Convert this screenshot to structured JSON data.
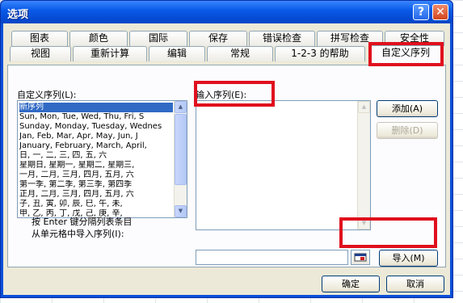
{
  "dialog": {
    "title": "选项",
    "help_label": "?",
    "close_label": "✕"
  },
  "tabs_row1": [
    "图表",
    "颜色",
    "国际",
    "保存",
    "错误检查",
    "拼写检查",
    "安全性"
  ],
  "tabs_row2": [
    "视图",
    "重新计算",
    "编辑",
    "常规",
    "1-2-3 的帮助",
    "自定义序列"
  ],
  "active_tab": "自定义序列",
  "custom_lists": {
    "label": "自定义序列(L):",
    "items": [
      "新序列",
      "Sun, Mon, Tue, Wed, Thu, Fri, S",
      "Sunday, Monday, Tuesday, Wednes",
      "Jan, Feb, Mar, Apr, May, Jun, J",
      "January, February, March, April,",
      "日, 一, 二, 三, 四, 五, 六",
      "星期日, 星期一, 星期二, 星期三,",
      "一月, 二月, 三月, 四月, 五月, 六",
      "第一季, 第二季, 第三季, 第四季",
      "正月, 二月, 三月, 四月, 五月, 六",
      "子, 丑, 寅, 卯, 辰, 巳, 午, 未,",
      "甲, 乙, 丙, 丁, 戊, 己, 庚, 辛,"
    ],
    "selected_index": 0
  },
  "entries": {
    "label": "输入序列(E):",
    "value": ""
  },
  "buttons": {
    "add": "添加(A)",
    "delete": "删除(D)",
    "import": "导入(M)",
    "ok": "确定",
    "cancel": "取消"
  },
  "import": {
    "hint_line1": "按 Enter 键分隔列表条目",
    "hint_line2": "从单元格中导入序列(I):",
    "value": ""
  },
  "icons": {
    "ref_button": "range-select-icon",
    "scroll_up": "scroll-up-arrow-icon",
    "scroll_down": "scroll-down-arrow-icon"
  },
  "colors": {
    "title_bar": "#0a5be8",
    "highlight": "#e0101d",
    "selection": "#316ac5",
    "dialog_face": "#ece9d8"
  }
}
